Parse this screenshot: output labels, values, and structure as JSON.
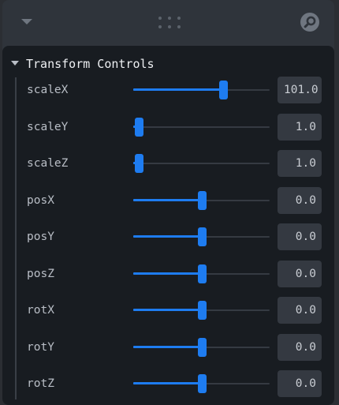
{
  "folder": {
    "title": "Transform Controls"
  },
  "controls": [
    {
      "label": "scaleX",
      "value": "101.0",
      "level": 0.66
    },
    {
      "label": "scaleY",
      "value": "1.0",
      "level": 0.04
    },
    {
      "label": "scaleZ",
      "value": "1.0",
      "level": 0.04
    },
    {
      "label": "posX",
      "value": "0.0",
      "level": 0.5
    },
    {
      "label": "posY",
      "value": "0.0",
      "level": 0.5
    },
    {
      "label": "posZ",
      "value": "0.0",
      "level": 0.5
    },
    {
      "label": "rotX",
      "value": "0.0",
      "level": 0.5
    },
    {
      "label": "rotY",
      "value": "0.0",
      "level": 0.5
    },
    {
      "label": "rotZ",
      "value": "0.0",
      "level": 0.5
    }
  ],
  "colors": {
    "accent": "#1e7cf0",
    "panel": "#2f343b",
    "folder": "#181c21"
  },
  "icons": {
    "collapse": "caret-down-icon",
    "drag": "drag-handle-icon",
    "search": "search-icon"
  }
}
